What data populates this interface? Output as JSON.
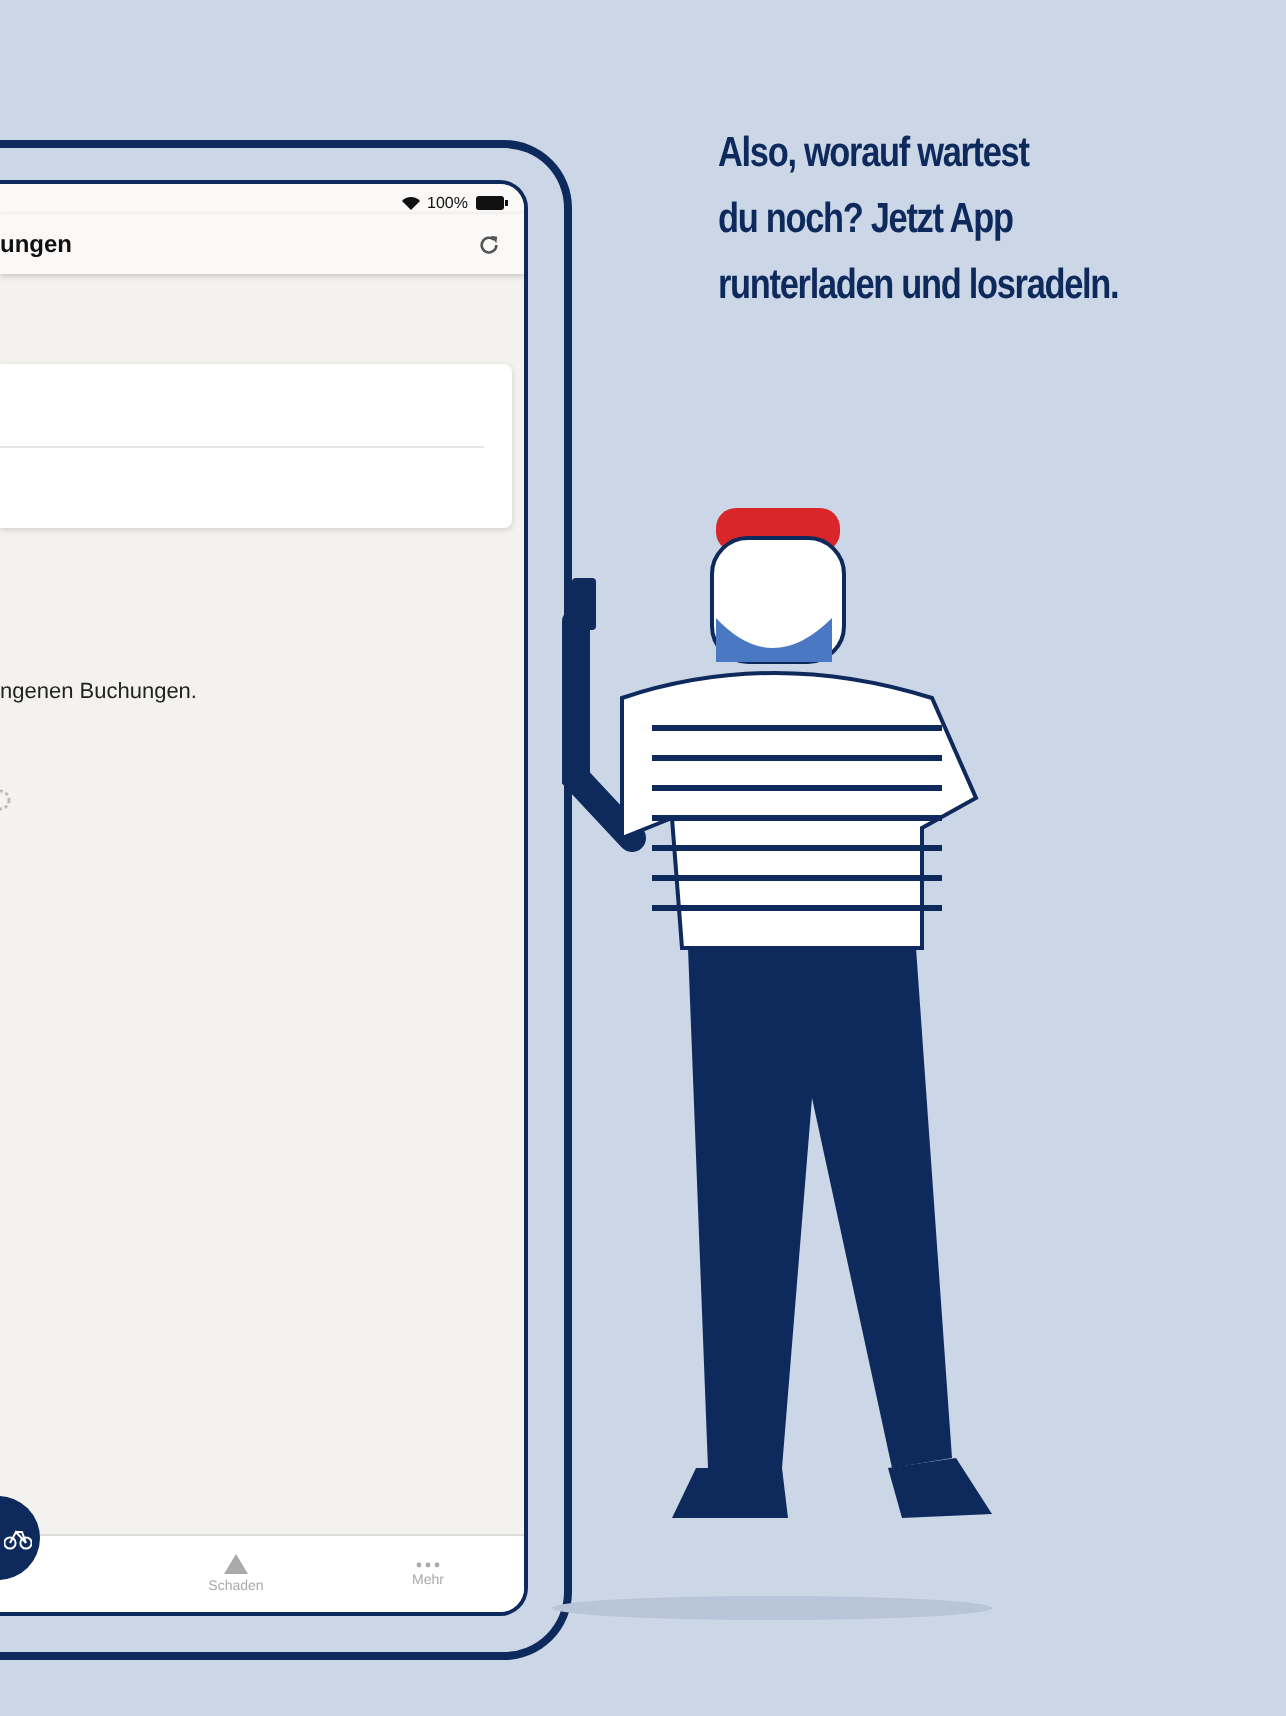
{
  "status_bar": {
    "battery": "100%"
  },
  "header": {
    "title": "ungen"
  },
  "message": "ngenen Buchungen.",
  "tab_bar": {
    "tabs": [
      {
        "label": "Schaden",
        "kind": "warning",
        "selected": false
      },
      {
        "label": "Mehr",
        "kind": "more",
        "selected": false
      }
    ]
  },
  "headline_lines": [
    "Also, worauf wartest",
    "du noch? Jetzt App",
    "runterladen und losradeln."
  ]
}
